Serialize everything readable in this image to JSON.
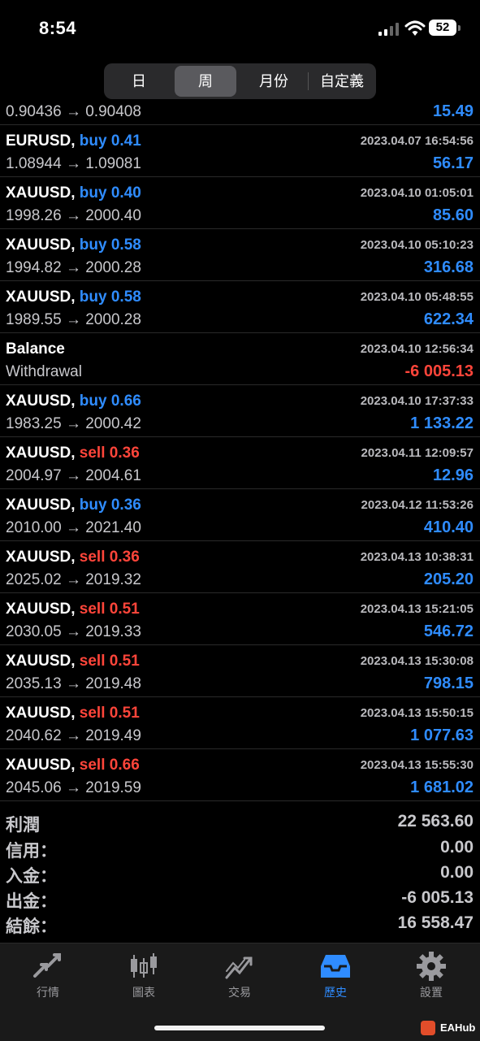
{
  "status": {
    "time": "8:54",
    "battery": "52"
  },
  "periods": {
    "day": "日",
    "week": "周",
    "month": "月份",
    "custom": "自定義"
  },
  "partial_row": {
    "prices": "0.90436 → 0.90408",
    "profit": "15.49"
  },
  "deals": [
    {
      "symbol": "EURUSD,",
      "side": "buy",
      "volume": "0.41",
      "date": "2023.04.07 16:54:56",
      "prices": "1.08944 → 1.09081",
      "profit": "56.17"
    },
    {
      "symbol": "XAUUSD,",
      "side": "buy",
      "volume": "0.40",
      "date": "2023.04.10 01:05:01",
      "prices": "1998.26 → 2000.40",
      "profit": "85.60"
    },
    {
      "symbol": "XAUUSD,",
      "side": "buy",
      "volume": "0.58",
      "date": "2023.04.10 05:10:23",
      "prices": "1994.82 → 2000.28",
      "profit": "316.68"
    },
    {
      "symbol": "XAUUSD,",
      "side": "buy",
      "volume": "0.58",
      "date": "2023.04.10 05:48:55",
      "prices": "1989.55 → 2000.28",
      "profit": "622.34"
    },
    {
      "symbol": "Balance",
      "side": "",
      "volume": "",
      "date": "2023.04.10 12:56:34",
      "prices": "Withdrawal",
      "profit": "-6 005.13"
    },
    {
      "symbol": "XAUUSD,",
      "side": "buy",
      "volume": "0.66",
      "date": "2023.04.10 17:37:33",
      "prices": "1983.25 → 2000.42",
      "profit": "1 133.22"
    },
    {
      "symbol": "XAUUSD,",
      "side": "sell",
      "volume": "0.36",
      "date": "2023.04.11 12:09:57",
      "prices": "2004.97 → 2004.61",
      "profit": "12.96"
    },
    {
      "symbol": "XAUUSD,",
      "side": "buy",
      "volume": "0.36",
      "date": "2023.04.12 11:53:26",
      "prices": "2010.00 → 2021.40",
      "profit": "410.40"
    },
    {
      "symbol": "XAUUSD,",
      "side": "sell",
      "volume": "0.36",
      "date": "2023.04.13 10:38:31",
      "prices": "2025.02 → 2019.32",
      "profit": "205.20"
    },
    {
      "symbol": "XAUUSD,",
      "side": "sell",
      "volume": "0.51",
      "date": "2023.04.13 15:21:05",
      "prices": "2030.05 → 2019.33",
      "profit": "546.72"
    },
    {
      "symbol": "XAUUSD,",
      "side": "sell",
      "volume": "0.51",
      "date": "2023.04.13 15:30:08",
      "prices": "2035.13 → 2019.48",
      "profit": "798.15"
    },
    {
      "symbol": "XAUUSD,",
      "side": "sell",
      "volume": "0.51",
      "date": "2023.04.13 15:50:15",
      "prices": "2040.62 → 2019.49",
      "profit": "1 077.63"
    },
    {
      "symbol": "XAUUSD,",
      "side": "sell",
      "volume": "0.66",
      "date": "2023.04.13 15:55:30",
      "prices": "2045.06 → 2019.59",
      "profit": "1 681.02"
    }
  ],
  "summary": {
    "profit_label": "利潤",
    "profit_value": "22 563.60",
    "credit_label": "信用：",
    "credit_value": "0.00",
    "deposit_label": "入金：",
    "deposit_value": "0.00",
    "withdrawal_label": "出金：",
    "withdrawal_value": "-6 005.13",
    "balance_label": "結餘：",
    "balance_value": "16 558.47"
  },
  "tabs": {
    "quotes": "行情",
    "chart": "圖表",
    "trade": "交易",
    "history": "歷史",
    "settings": "設置"
  },
  "watermark": "EAHub",
  "colors": {
    "buy": "#2f8cff",
    "sell": "#ff453a",
    "accent": "#2f8cff",
    "background": "#000000"
  },
  "icons": {
    "quotes": "arrows-icon",
    "chart": "candlestick-icon",
    "trade": "trend-icon",
    "history": "inbox-icon",
    "settings": "gear-icon"
  }
}
